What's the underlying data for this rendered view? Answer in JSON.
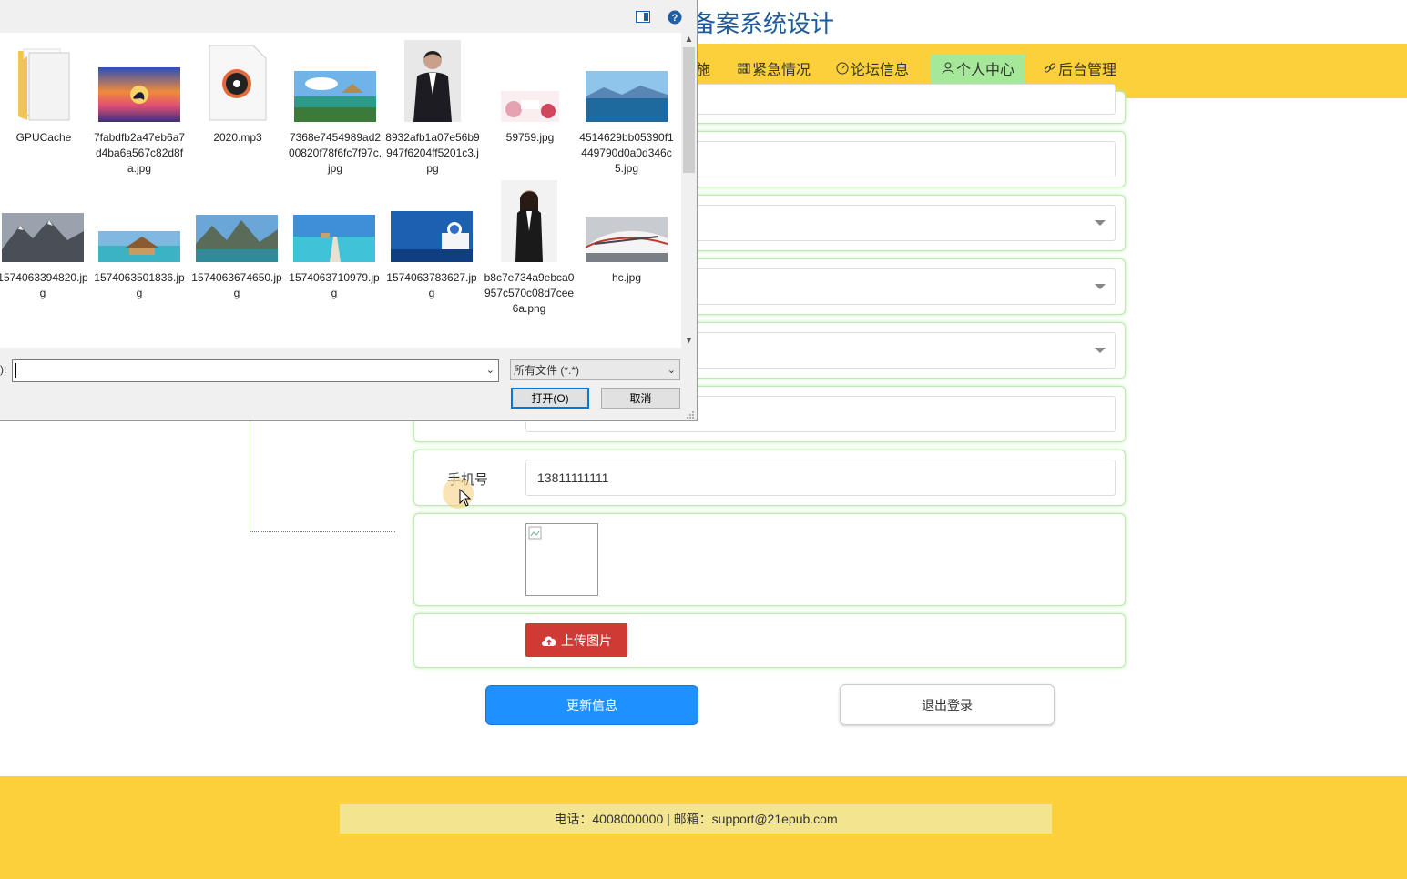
{
  "site": {
    "title_partial": "备案系统设计"
  },
  "nav": [
    {
      "label": "施",
      "icon": "none"
    },
    {
      "label": "紧急情况",
      "icon": "grid-icon"
    },
    {
      "label": "论坛信息",
      "icon": "gauge-icon"
    },
    {
      "label": "个人中心",
      "icon": "user-icon",
      "active": true
    },
    {
      "label": "后台管理",
      "icon": "link-icon"
    }
  ],
  "form": {
    "phone_label": "手机号",
    "phone_value": "13811111111",
    "upload_label": "上传图片",
    "update_label": "更新信息",
    "logout_label": "退出登录"
  },
  "footer": {
    "text": "电话：4008000000 | 邮箱：support@21epub.com"
  },
  "dialog": {
    "filename_label_partial": "):",
    "filename_value": "",
    "filetype_value": "所有文件 (*.*)",
    "open_label": "打开(O)",
    "cancel_label": "取消",
    "files": [
      {
        "name": "GPUCache",
        "kind": "folder"
      },
      {
        "name": "7fabdfb2a47eb6a7d4ba6a567c82d8fa.jpg",
        "kind": "image"
      },
      {
        "name": "2020.mp3",
        "kind": "audio"
      },
      {
        "name": "7368e7454989ad200820f78f6fc7f97c.jpg",
        "kind": "image"
      },
      {
        "name": "8932afb1a07e56b9947f6204ff5201c3.jpg",
        "kind": "image"
      },
      {
        "name": "59759.jpg",
        "kind": "image"
      },
      {
        "name": "4514629bb05390f1449790d0a0d346c5.jpg",
        "kind": "image"
      },
      {
        "name": "1574063394820.jpg",
        "kind": "image"
      },
      {
        "name": "1574063501836.jpg",
        "kind": "image"
      },
      {
        "name": "1574063674650.jpg",
        "kind": "image"
      },
      {
        "name": "1574063710979.jpg",
        "kind": "image"
      },
      {
        "name": "1574063783627.jpg",
        "kind": "image"
      },
      {
        "name": "b8c7e734a9ebca0957c570c08d7cee6a.png",
        "kind": "image"
      },
      {
        "name": "hc.jpg",
        "kind": "image"
      }
    ]
  }
}
